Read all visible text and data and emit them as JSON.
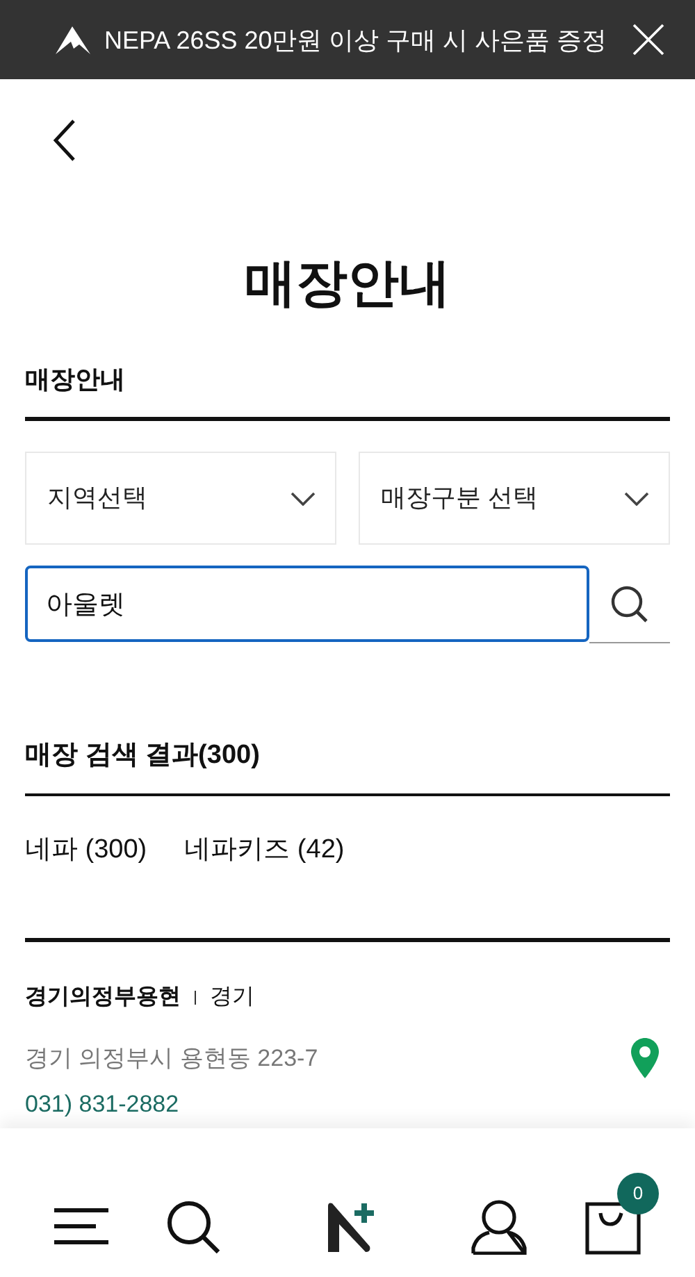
{
  "banner": {
    "text": "NEPA 26SS 20만원 이상 구매 시 사은품 증정"
  },
  "page_title": "매장안내",
  "section_title": "매장안내",
  "filters": [
    {
      "label": "지역선택"
    },
    {
      "label": "매장구분 선택"
    }
  ],
  "search": {
    "value": "아울렛"
  },
  "results_title": "매장 검색 결과(300)",
  "brand_tabs": [
    {
      "label": "네파 (300)"
    },
    {
      "label": "네파키즈 (42)"
    }
  ],
  "stores": [
    {
      "name": "경기의정부용현",
      "region": "경기",
      "address": "경기 의정부시 용현동 223-7",
      "phone": "031) 831-2882"
    }
  ],
  "cart": {
    "count": "0"
  }
}
